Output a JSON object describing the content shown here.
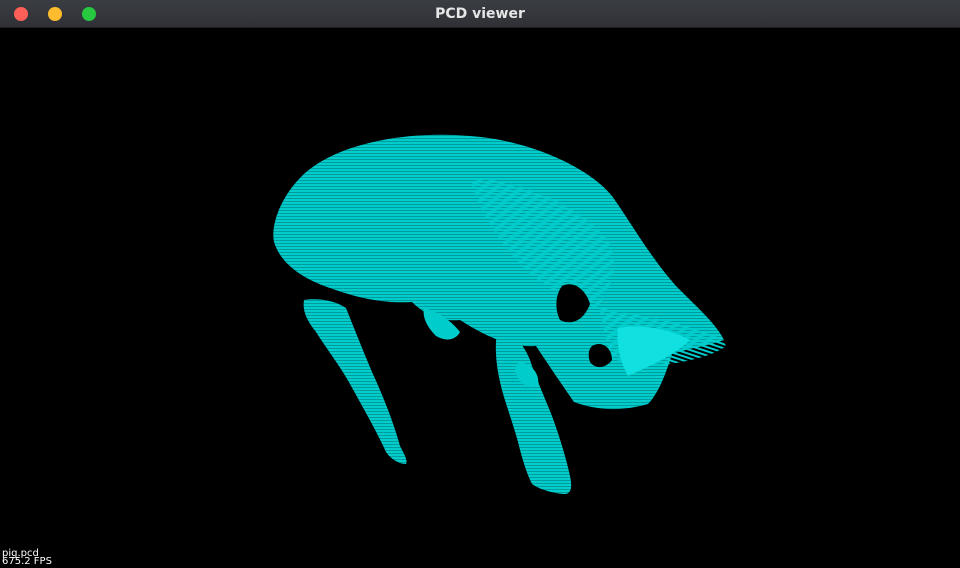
{
  "window": {
    "title": "PCD viewer",
    "controls": {
      "close_color": "#fe5f57",
      "minimize_color": "#febc2e",
      "maximize_color": "#28c840"
    }
  },
  "viewer": {
    "background_color": "#000000",
    "point_color": "#00cccc",
    "file_label": "pig.pcd",
    "fps_label": "675.2 FPS"
  }
}
